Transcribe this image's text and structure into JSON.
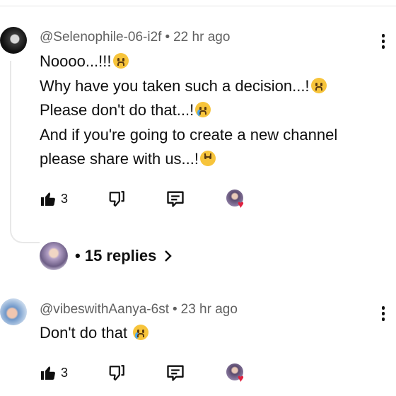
{
  "comments": [
    {
      "author": "@Selenophile-06-i2f",
      "time": "22 hr ago",
      "lines": [
        {
          "text": "Noooo...!!!",
          "emoji": "weary-face-emoji"
        },
        {
          "text": "Why have you taken such a decision...!",
          "emoji": "worried-face-emoji"
        },
        {
          "text": "Please don't do that...!",
          "emoji": "crying-face-emoji"
        },
        {
          "text": "And if you're going to create a new channel",
          "emoji": null
        },
        {
          "text": "please share with us...!",
          "emoji": "upside-down-face-emoji"
        }
      ],
      "likes": "3",
      "replies_label": "15 replies"
    },
    {
      "author": "@vibeswithAanya-6st",
      "time": "23 hr ago",
      "lines": [
        {
          "text": "Don't do that ",
          "emoji": "sad-tear-face-emoji"
        }
      ],
      "likes": "3"
    }
  ],
  "separator": "•",
  "colors": {
    "heart": "#e0213f",
    "meta_text": "#606060",
    "text": "#0f0f0f"
  }
}
